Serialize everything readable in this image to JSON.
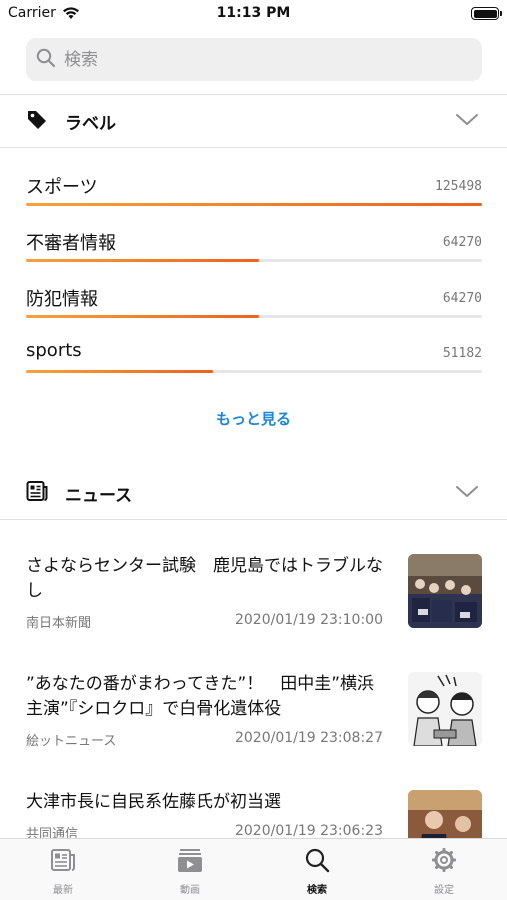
{
  "status": {
    "carrier": "Carrier",
    "time": "11:13 PM"
  },
  "search": {
    "placeholder": "検索"
  },
  "labels_section": {
    "title": "ラベル",
    "items": [
      {
        "name": "スポーツ",
        "count": "125498",
        "fraction": 1.0
      },
      {
        "name": "不審者情報",
        "count": "64270",
        "fraction": 0.51
      },
      {
        "name": "防犯情報",
        "count": "64270",
        "fraction": 0.51
      },
      {
        "name": "sports",
        "count": "51182",
        "fraction": 0.41
      }
    ],
    "more_label": "もっと見る"
  },
  "news_section": {
    "title": "ニュース",
    "items": [
      {
        "headline": "さよならセンター試験　鹿児島ではトラブルなし",
        "source": "南日本新聞",
        "date": "2020/01/19 23:10:00",
        "thumb": "students-photo"
      },
      {
        "headline": "”あなたの番がまわってきた”！　田中圭”横浜主演”『シロクロ』で白骨化遺体役",
        "source": "絵ットニュース",
        "date": "2020/01/19 23:08:27",
        "thumb": "manga-drawing"
      },
      {
        "headline": "大津市長に自民系佐藤氏が初当選",
        "source": "共同通信",
        "date": "2020/01/19 23:06:23",
        "thumb": "election-photo"
      }
    ]
  },
  "tabbar": {
    "tabs": [
      {
        "label": "最新",
        "icon": "news-icon",
        "active": false
      },
      {
        "label": "動画",
        "icon": "video-icon",
        "active": false
      },
      {
        "label": "検索",
        "icon": "search-icon",
        "active": true
      },
      {
        "label": "設定",
        "icon": "gear-icon",
        "active": false
      }
    ]
  },
  "colors": {
    "accent_orange": "#e9631d",
    "link_blue": "#1d86d8"
  }
}
